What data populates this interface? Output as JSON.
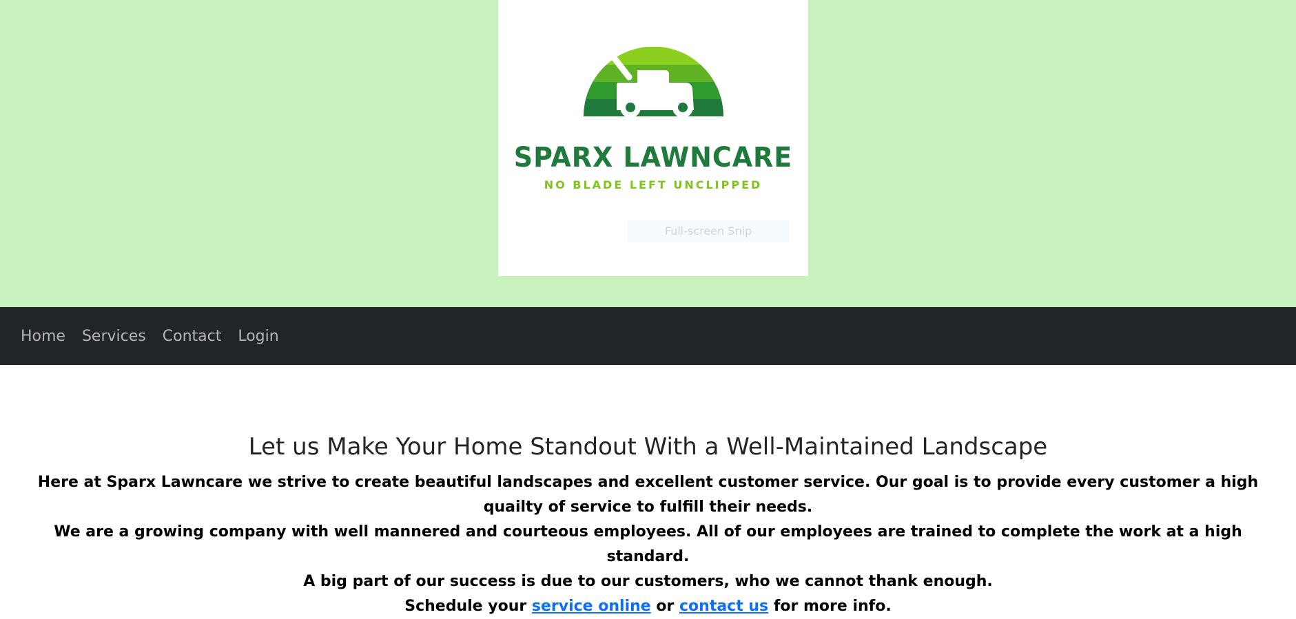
{
  "brand": {
    "name": "SPARX LAWNCARE",
    "tagline": "NO BLADE LEFT UNCLIPPED",
    "primary_color": "#1f7a3c",
    "accent_color": "#7fc31c",
    "logo_icon": "lawn-mower-icon"
  },
  "snip_overlay": "Full-screen Snip",
  "nav": {
    "items": [
      {
        "label": "Home"
      },
      {
        "label": "Services"
      },
      {
        "label": "Contact"
      },
      {
        "label": "Login"
      }
    ]
  },
  "main": {
    "heading": "Let us Make Your Home Standout With a Well-Maintained Landscape",
    "paragraph_1": "Here at Sparx Lawncare we strive to create beautiful landscapes and excellent customer service. Our goal is to provide every customer a high quailty of service to fulfill their needs.",
    "paragraph_2": "We are a growing company with well mannered and courteous employees. All of our employees are trained to complete the work at a high standard.",
    "paragraph_3": "A big part of our success is due to our customers, who we cannot thank enough.",
    "schedule": {
      "prefix": "Schedule your ",
      "link_service": "service online",
      "middle": " or ",
      "link_contact": "contact us",
      "suffix": " for more info."
    }
  },
  "colors": {
    "hero_bg": "#c8f1bd",
    "navbar_bg": "#212529",
    "link": "#0d6efd"
  }
}
